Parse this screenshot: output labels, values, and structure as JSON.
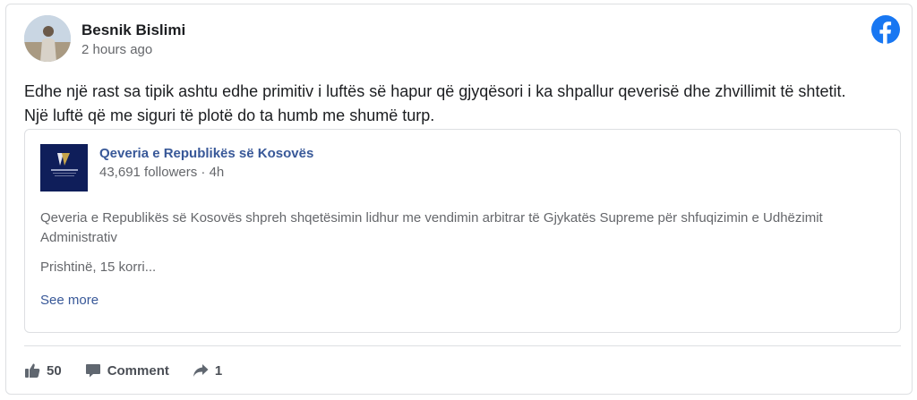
{
  "post": {
    "author": "Besnik Bislimi",
    "time": "2 hours ago",
    "text_line1": "Edhe një rast sa tipik ashtu edhe primitiv i luftës së hapur që gjyqësori i ka shpallur qeverisë dhe zhvillimit të shtetit.",
    "text_line2": "Një luftë që me siguri të plotë do ta humb me shumë turp."
  },
  "embed": {
    "page_name": "Qeveria e Republikës së Kosovës",
    "followers": "43,691 followers",
    "separator": " · ",
    "age": "4h",
    "text": "Qeveria e Republikës së Kosovës shpreh shqetësimin lidhur me vendimin arbitrar të Gjykatës Supreme për shfuqizimin e Udhëzimit Administrativ",
    "text2": "Prishtinë, 15 korri...",
    "see_more": "See more"
  },
  "actions": {
    "likes": "50",
    "comment": "Comment",
    "shares": "1"
  },
  "icons": [
    "facebook-icon",
    "like-icon",
    "comment-icon",
    "share-icon"
  ],
  "colors": {
    "facebook_blue": "#1877f2",
    "link_blue": "#385898",
    "secondary_text": "#65676b",
    "border": "#dddfe2"
  }
}
